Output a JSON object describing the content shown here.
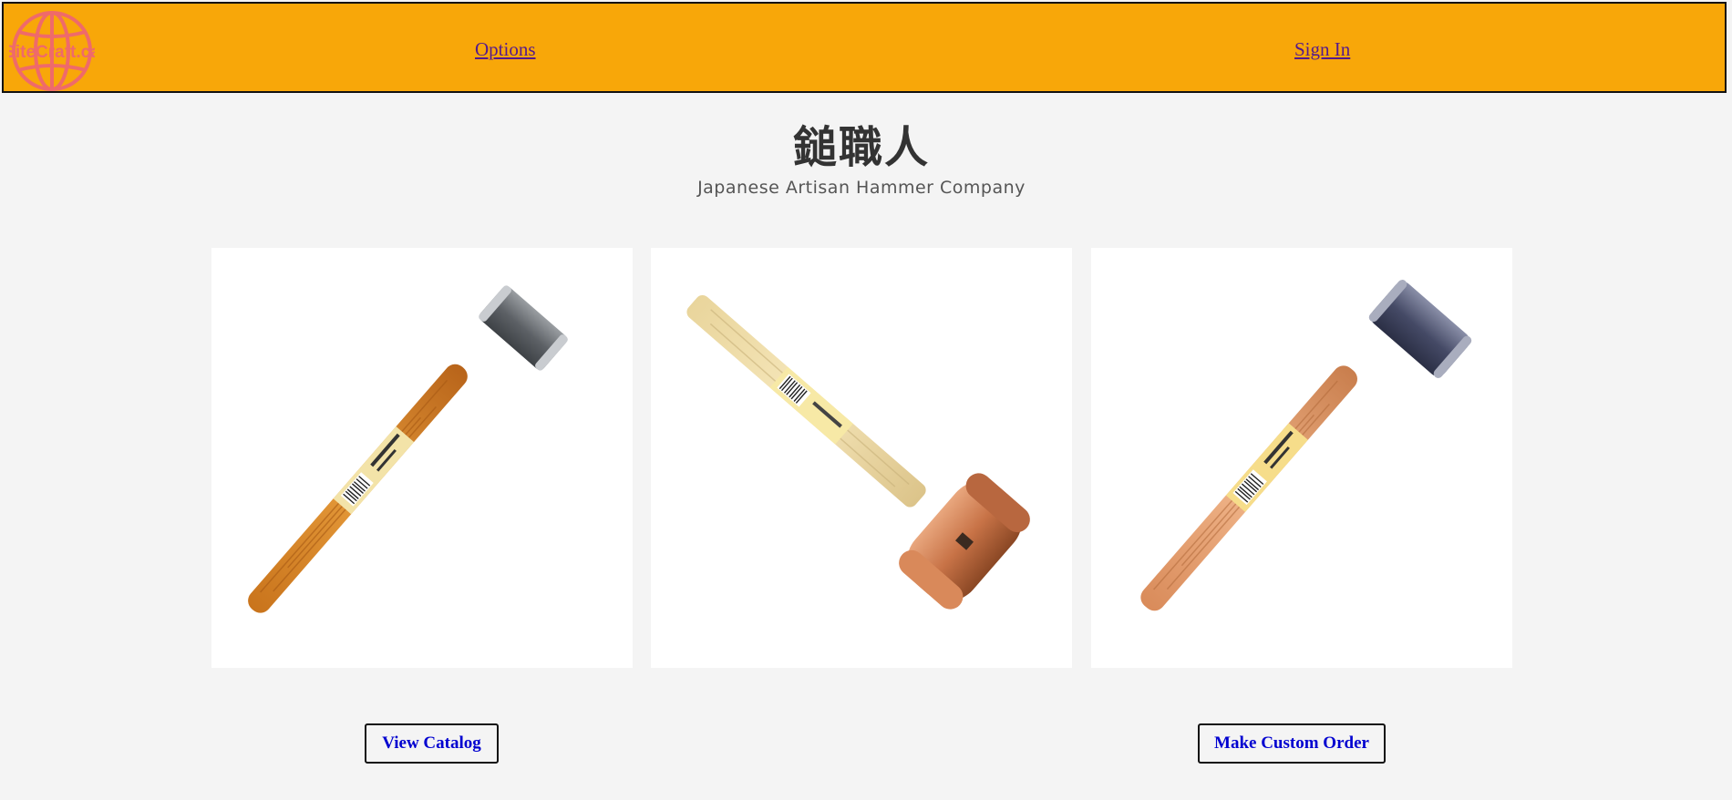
{
  "header": {
    "logo_text": "SiteCraft.ca",
    "nav": {
      "options_label": "Options",
      "signin_label": "Sign In"
    },
    "colors": {
      "bar": "#f8a709",
      "logo": "#ef6a6a",
      "link": "#551a8b"
    }
  },
  "hero": {
    "title": "鎚職人",
    "subtitle": "Japanese Artisan Hammer Company"
  },
  "products": [
    {
      "image": "oak-handle-hammer-steel-head"
    },
    {
      "image": "pale-wood-handle-copper-head-hammer"
    },
    {
      "image": "oak-handle-hammer-dark-steel-head"
    }
  ],
  "actions": {
    "view_catalog_label": "View Catalog",
    "custom_order_label": "Make Custom Order"
  }
}
